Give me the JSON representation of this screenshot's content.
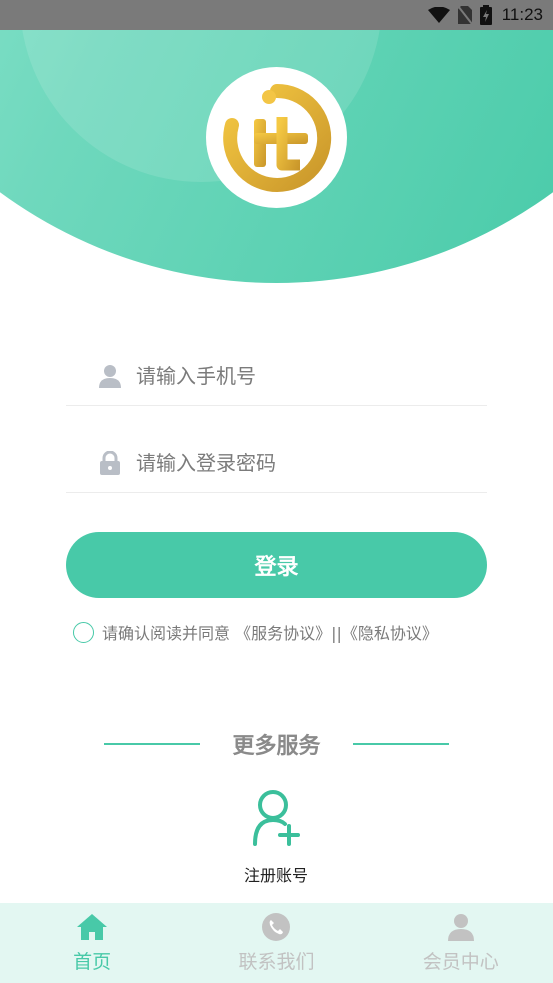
{
  "status_bar": {
    "time": "11:23"
  },
  "login_form": {
    "phone_placeholder": "请输入手机号",
    "password_placeholder": "请输入登录密码",
    "login_label": "登录",
    "agreement_text": "请确认阅读并同意 《服务协议》||《隐私协议》"
  },
  "more_services": {
    "title": "更多服务",
    "register_label": "注册账号"
  },
  "tab_bar": {
    "tabs": [
      {
        "label": "首页",
        "icon": "home-icon",
        "active": true
      },
      {
        "label": "联系我们",
        "icon": "phone-icon",
        "active": false
      },
      {
        "label": "会员中心",
        "icon": "user-icon",
        "active": false
      }
    ]
  },
  "colors": {
    "accent": "#48c9a8",
    "tab_bar_bg": "#e3f7f2",
    "logo_gold": "#e2b43a",
    "inactive": "#c2c2c2"
  }
}
